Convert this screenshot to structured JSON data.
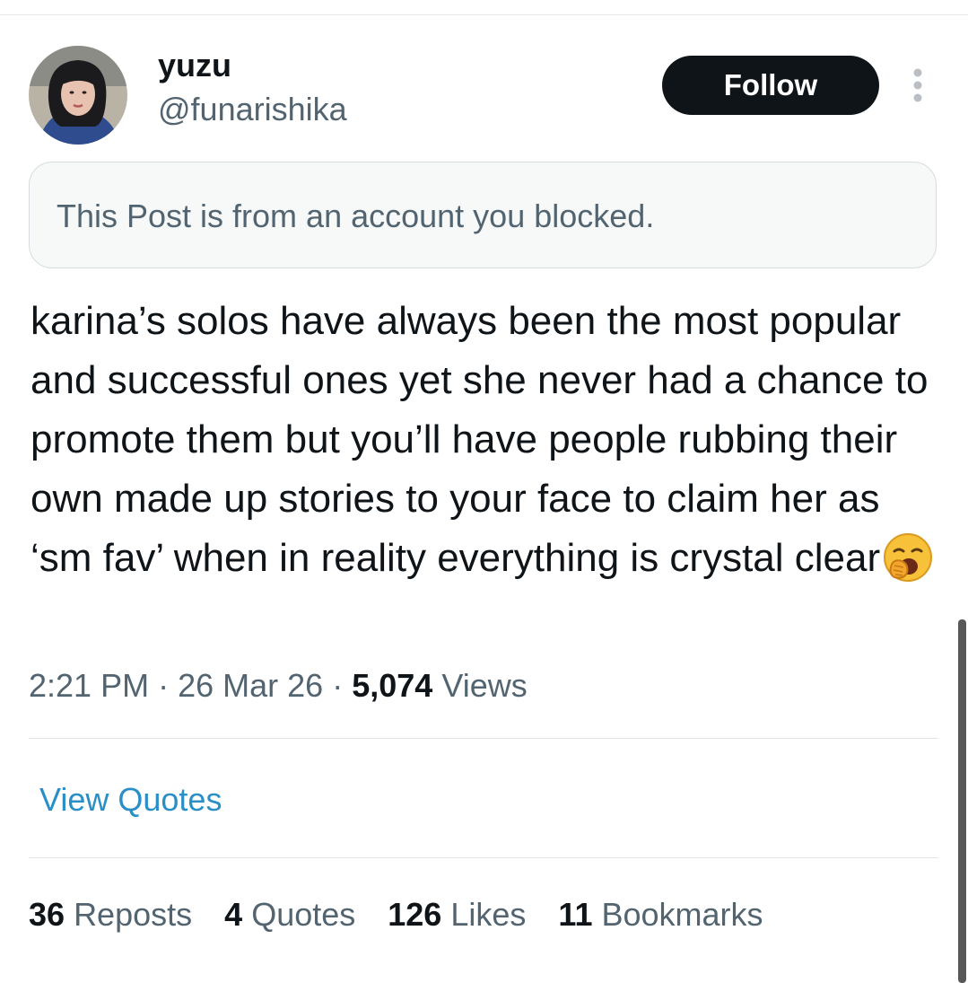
{
  "author": {
    "name": "yuzu",
    "handle": "@funarishika",
    "avatar_icon": "user-avatar-photo"
  },
  "follow_button_label": "Follow",
  "more_icon": "more-vertical-icon",
  "blocked_notice": "This Post is from an account you blocked.",
  "post": {
    "text": "karina’s solos have always been the most popular and successful ones yet she never had a chance to promote them but you’ll have people rubbing their own made up stories to your face to claim her as ‘sm fav’ when in reality everything is crystal clear",
    "emoji": "yawning-face-emoji"
  },
  "meta": {
    "time": "2:21 PM",
    "separator": "·",
    "date": "26 Mar 26",
    "views_count": "5,074",
    "views_label": "Views"
  },
  "view_quotes_label": "View Quotes",
  "stats": [
    {
      "count": "36",
      "label": "Reposts"
    },
    {
      "count": "4",
      "label": "Quotes"
    },
    {
      "count": "126",
      "label": "Likes"
    },
    {
      "count": "11",
      "label": "Bookmarks"
    }
  ],
  "colors": {
    "text_primary": "#0f1419",
    "text_secondary": "#536471",
    "link": "#2b8fc7",
    "button_bg": "#0f1419",
    "notice_bg": "#f7f9f9"
  }
}
